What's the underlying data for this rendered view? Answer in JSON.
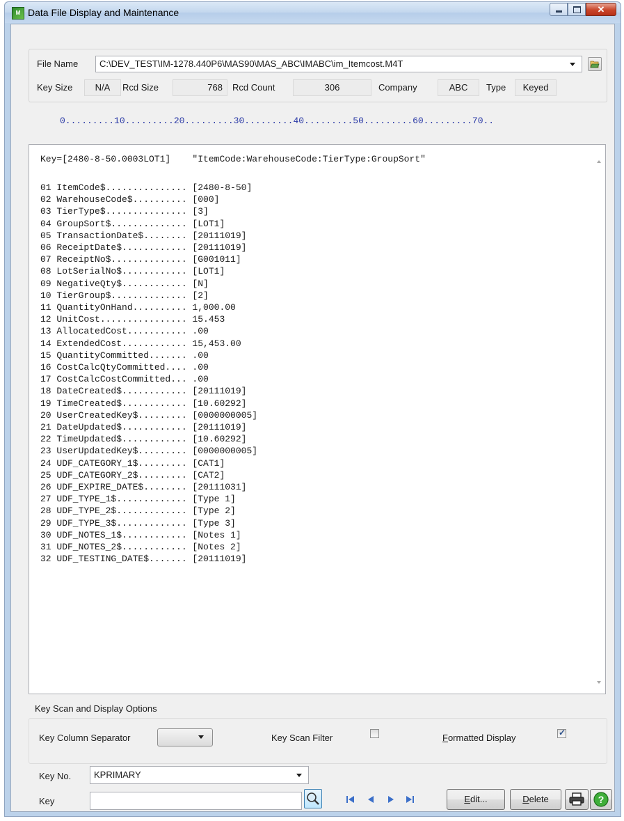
{
  "window": {
    "title": "Data File Display and Maintenance",
    "app_icon": "MAS-app-icon",
    "controls": [
      "minimize-icon",
      "maximize-icon",
      "close-icon"
    ]
  },
  "file_info": {
    "file_name_label": "File Name",
    "file_name_value": "C:\\DEV_TEST\\IM-1278.440P6\\MAS90\\MAS_ABC\\IMABC\\im_Itemcost.M4T",
    "key_size_label": "Key Size",
    "key_size_value": "N/A",
    "rcd_size_label": "Rcd Size",
    "rcd_size_value": "768",
    "rcd_count_label": "Rcd Count",
    "rcd_count_value": "306",
    "company_label": "Company",
    "company_value": "ABC",
    "type_label": "Type",
    "type_value": "Keyed"
  },
  "ruler": "0.........10.........20.........30.........40.........50.........60.........70..",
  "record": {
    "key_line": "Key=[2480-8-50.0003LOT1]    \"ItemCode:WarehouseCode:TierType:GroupSort\"",
    "fields": [
      "01 ItemCode$............... [2480-8-50]",
      "02 WarehouseCode$.......... [000]",
      "03 TierType$............... [3]",
      "04 GroupSort$.............. [LOT1]",
      "05 TransactionDate$........ [20111019]",
      "06 ReceiptDate$............ [20111019]",
      "07 ReceiptNo$.............. [G001011]",
      "08 LotSerialNo$............ [LOT1]",
      "09 NegativeQty$............ [N]",
      "10 TierGroup$.............. [2]",
      "11 QuantityOnHand.......... 1,000.00",
      "12 UnitCost................ 15.453",
      "13 AllocatedCost........... .00",
      "14 ExtendedCost............ 15,453.00",
      "15 QuantityCommitted....... .00",
      "16 CostCalcQtyCommitted.... .00",
      "17 CostCalcCostCommitted... .00",
      "18 DateCreated$............ [20111019]",
      "19 TimeCreated$............ [10.60292]",
      "20 UserCreatedKey$......... [0000000005]",
      "21 DateUpdated$............ [20111019]",
      "22 TimeUpdated$............ [10.60292]",
      "23 UserUpdatedKey$......... [0000000005]",
      "24 UDF_CATEGORY_1$......... [CAT1]",
      "25 UDF_CATEGORY_2$......... [CAT2]",
      "26 UDF_EXPIRE_DATE$........ [20111031]",
      "27 UDF_TYPE_1$............. [Type 1]",
      "28 UDF_TYPE_2$............. [Type 2]",
      "29 UDF_TYPE_3$............. [Type 3]",
      "30 UDF_NOTES_1$............ [Notes 1]",
      "31 UDF_NOTES_2$............ [Notes 2]",
      "32 UDF_TESTING_DATE$....... [20111019]"
    ]
  },
  "options": {
    "group_title": "Key Scan and Display Options",
    "key_column_separator_label": "Key Column Separator",
    "key_column_separator_value": "",
    "key_scan_filter_label": "Key Scan Filter",
    "key_scan_filter_checked": false,
    "formatted_display_label": "Formatted Display",
    "formatted_display_checked": true
  },
  "bottom": {
    "key_no_label": "Key No.",
    "key_no_value": "KPRIMARY",
    "key_label": "Key",
    "key_value": "",
    "edit_button": "Edit...",
    "delete_button": "Delete"
  },
  "icons": {
    "browse": "folder-open-icon",
    "lookup": "magnifier-icon",
    "nav": [
      "first-record-icon",
      "previous-record-icon",
      "next-record-icon",
      "last-record-icon"
    ],
    "print": "printer-icon",
    "help": "help-icon"
  }
}
